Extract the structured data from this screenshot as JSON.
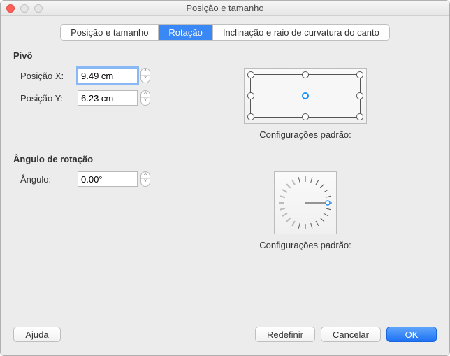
{
  "window": {
    "title": "Posição e tamanho"
  },
  "tabs": {
    "pos": "Posição e tamanho",
    "rot": "Rotação",
    "slant": "Inclinação e raio de curvatura do canto"
  },
  "pivot": {
    "title": "Pivô",
    "posx_label": "Posição X:",
    "posx_value": "9.49 cm",
    "posy_label": "Posição Y:",
    "posy_value": "6.23 cm",
    "caption": "Configurações padrão:"
  },
  "rotation": {
    "title": "Ângulo de rotação",
    "angle_label": "Ângulo:",
    "angle_value": "0.00°",
    "caption": "Configurações padrão:"
  },
  "buttons": {
    "help": "Ajuda",
    "reset": "Redefinir",
    "cancel": "Cancelar",
    "ok": "OK"
  }
}
